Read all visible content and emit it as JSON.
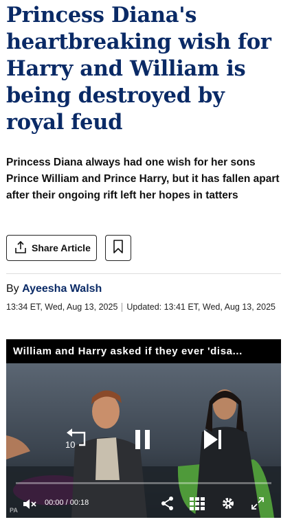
{
  "article": {
    "headline": "Princess Diana's heartbreaking wish for Harry and William is being destroyed by royal feud",
    "dek": "Princess Diana always had one wish for her sons Prince William and Prince Harry, but it has fallen apart after their ongoing rift left her hopes in tatters",
    "share_label": "Share Article",
    "byline_prefix": "By",
    "author": "Ayeesha Walsh",
    "published": "13:34 ET, Wed, Aug 13, 2025",
    "updated": "Updated: 13:41 ET, Wed, Aug 13, 2025"
  },
  "video": {
    "title": "William and Harry asked if they ever 'disa...",
    "current_time": "00:00",
    "separator": "/",
    "duration": "00:18",
    "rewind_seconds": "10",
    "watermark": "PA",
    "progress": 0.0
  },
  "icons": {
    "share": "share-icon",
    "bookmark": "bookmark-icon",
    "rewind": "rewind-10-icon",
    "pause": "pause-icon",
    "skip": "skip-next-icon",
    "mute": "mute-icon",
    "captions": "captions-icon",
    "playlist": "playlist-grid-icon",
    "settings": "settings-icon",
    "fullscreen": "fullscreen-icon"
  },
  "colors": {
    "headline": "#0a2a66",
    "author": "#0a2a66",
    "video_bar": "#000000"
  }
}
